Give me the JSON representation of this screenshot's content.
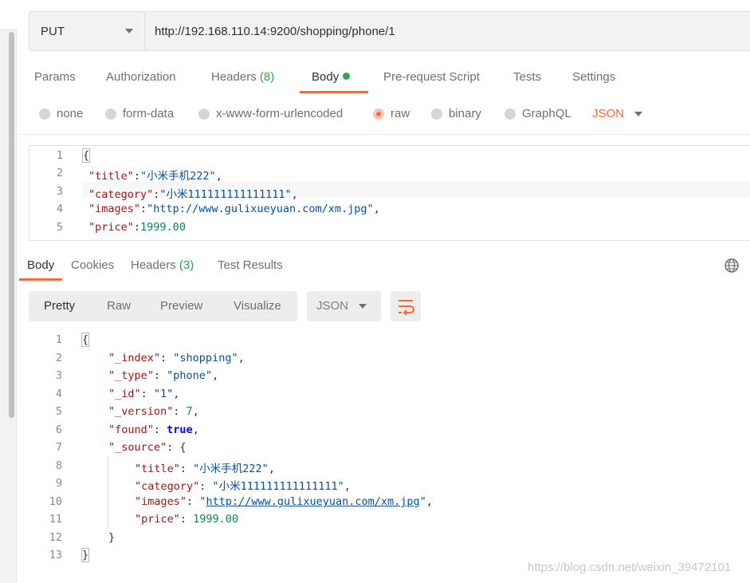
{
  "request": {
    "method": "PUT",
    "url": "http://192.168.110.14:9200/shopping/phone/1",
    "tabs": [
      {
        "label": "Params"
      },
      {
        "label": "Authorization"
      },
      {
        "label": "Headers",
        "count": "(8)"
      },
      {
        "label": "Body"
      },
      {
        "label": "Pre-request Script"
      },
      {
        "label": "Tests"
      },
      {
        "label": "Settings"
      }
    ],
    "body_types": [
      "none",
      "form-data",
      "x-www-form-urlencoded",
      "raw",
      "binary",
      "GraphQL"
    ],
    "selected_body_type": "raw",
    "raw_format": "JSON",
    "editor": {
      "line_numbers": [
        "1",
        "2",
        "3",
        "4",
        "5"
      ],
      "lines": [
        {
          "open": "{"
        },
        {
          "key": "\"title\"",
          "value": "\"小米手机222\"",
          "tail": ","
        },
        {
          "key": "\"category\"",
          "value": "\"小米111111111111111\"",
          "tail": ","
        },
        {
          "key": "\"images\"",
          "value": "\"http://www.gulixueyuan.com/xm.jpg\"",
          "tail": ","
        },
        {
          "key": "\"price\"",
          "value": "1999.00",
          "tail": ""
        }
      ]
    }
  },
  "response": {
    "tabs": [
      {
        "label": "Body"
      },
      {
        "label": "Cookies"
      },
      {
        "label": "Headers",
        "count": "(3)"
      },
      {
        "label": "Test Results"
      }
    ],
    "views": [
      "Pretty",
      "Raw",
      "Preview",
      "Visualize"
    ],
    "active_view": "Pretty",
    "format": "JSON",
    "line_numbers": [
      "1",
      "2",
      "3",
      "4",
      "5",
      "6",
      "7",
      "8",
      "9",
      "10",
      "11",
      "12",
      "13"
    ],
    "json": {
      "open": "{",
      "index_key": "\"_index\"",
      "index_val": "\"shopping\"",
      "type_key": "\"_type\"",
      "type_val": "\"phone\"",
      "id_key": "\"_id\"",
      "id_val": "\"1\"",
      "version_key": "\"_version\"",
      "version_val": "7",
      "found_key": "\"found\"",
      "found_val": "true",
      "source_key": "\"_source\"",
      "source_open": "{",
      "title_key": "\"title\"",
      "title_val": "\"小米手机222\"",
      "category_key": "\"category\"",
      "category_val": "\"小米111111111111111\"",
      "images_key": "\"images\"",
      "images_q1": "\"",
      "images_url": "http://www.gulixueyuan.com/xm.jpg",
      "images_q2": "\"",
      "price_key": "\"price\"",
      "price_val": "1999.00",
      "source_close": "}",
      "close": "}"
    }
  },
  "watermark": "https://blog.csdn.net/weixin_39472101"
}
